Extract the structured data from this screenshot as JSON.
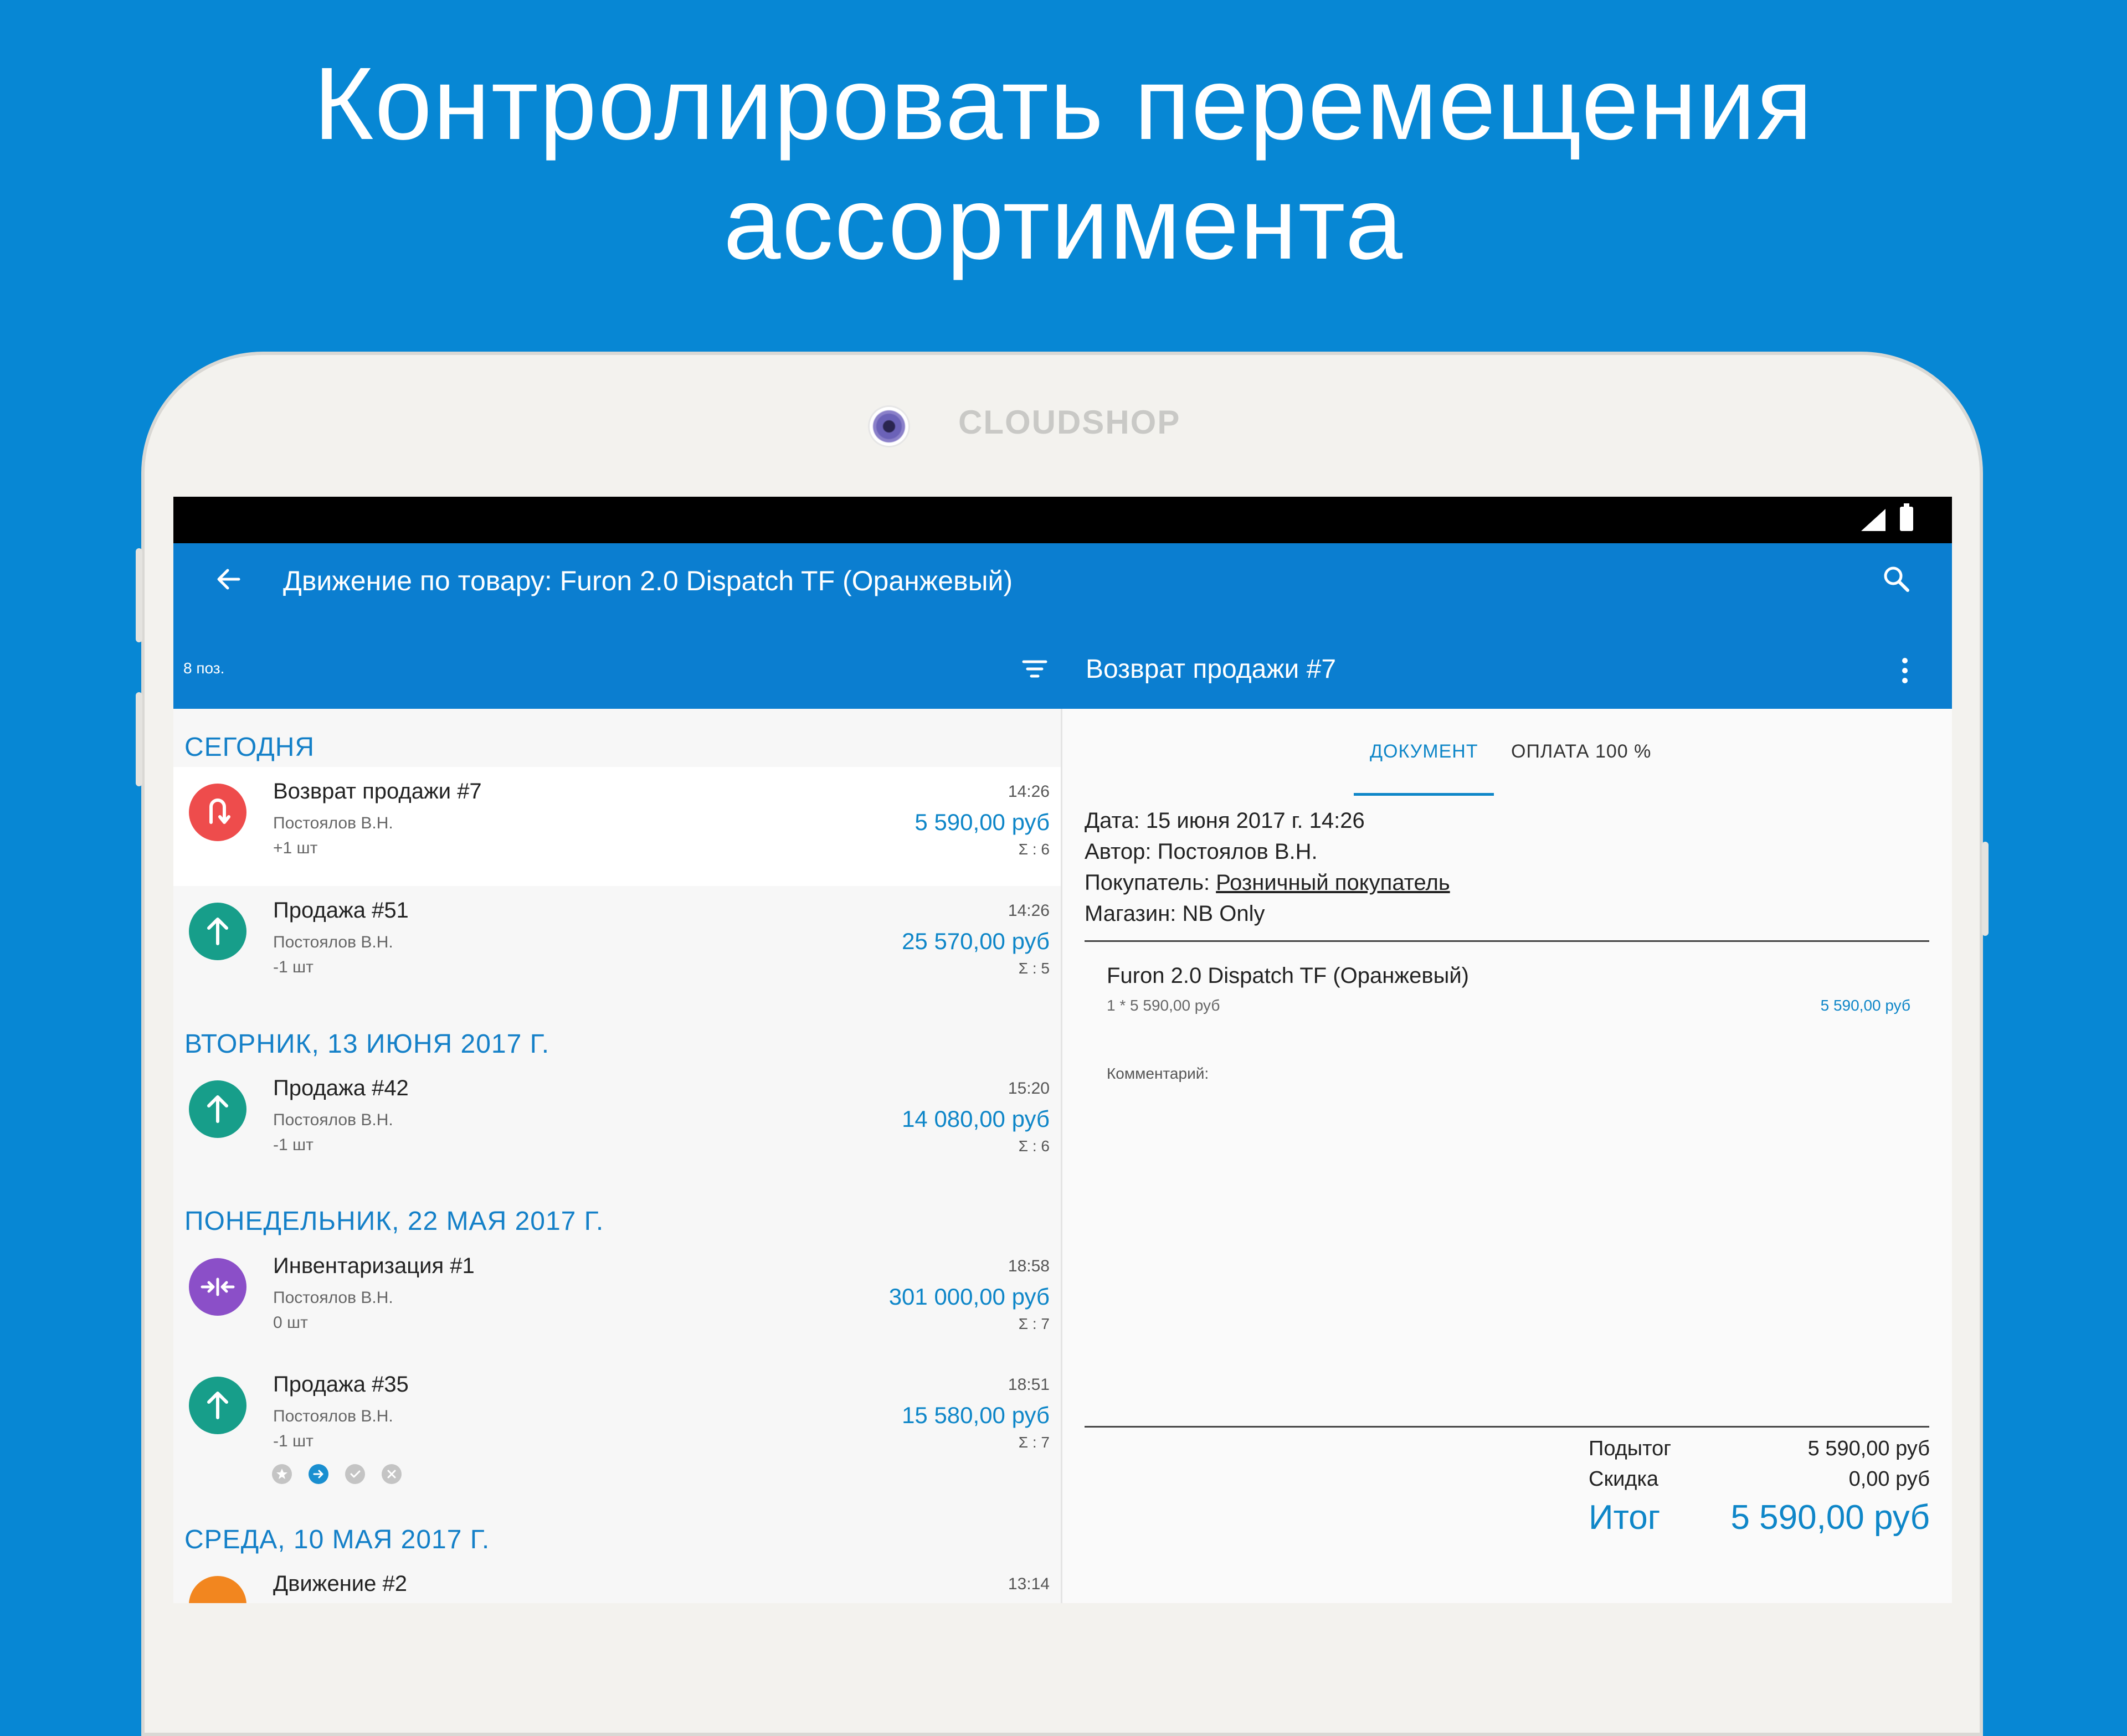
{
  "headline": {
    "line1": "Контролировать перемещения",
    "line2": "ассортимента"
  },
  "device": {
    "brand": "CLOUDSHOP"
  },
  "app": {
    "title": "Движение по товару: Furon 2.0 Dispatch TF (Оранжевый)",
    "count_label": "8 поз.",
    "detail_title": "Возврат продажи #7"
  },
  "list": {
    "sections": [
      "СЕГОДНЯ",
      "ВТОРНИК, 13 ИЮНЯ 2017 Г.",
      "ПОНЕДЕЛЬНИК, 22 МАЯ 2017 Г.",
      "СРЕДА, 10 МАЯ 2017 Г."
    ],
    "items": [
      {
        "title": "Возврат продажи #7",
        "author": "Постоялов В.Н.",
        "qty": "+1 шт",
        "time": "14:26",
        "sum": "5 590,00 руб",
        "count": "Σ : 6",
        "icon": "return-icon",
        "color": "#ee4c4c"
      },
      {
        "title": "Продажа #51",
        "author": "Постоялов В.Н.",
        "qty": "-1 шт",
        "time": "14:26",
        "sum": "25 570,00 руб",
        "count": "Σ : 5",
        "icon": "arrow-up-icon",
        "color": "#179e8a"
      },
      {
        "title": "Продажа #42",
        "author": "Постоялов В.Н.",
        "qty": "-1 шт",
        "time": "15:20",
        "sum": "14 080,00 руб",
        "count": "Σ : 6",
        "icon": "arrow-up-icon",
        "color": "#179e8a"
      },
      {
        "title": "Инвентаризация #1",
        "author": "Постоялов В.Н.",
        "qty": "0 шт",
        "time": "18:58",
        "sum": "301 000,00 руб",
        "count": "Σ : 7",
        "icon": "inventory-icon",
        "color": "#8b4fc8"
      },
      {
        "title": "Продажа #35",
        "author": "Постоялов В.Н.",
        "qty": "-1 шт",
        "time": "18:51",
        "sum": "15 580,00 руб",
        "count": "Σ : 7",
        "icon": "arrow-up-icon",
        "color": "#179e8a"
      },
      {
        "title": "Движение #2",
        "time": "13:14",
        "icon": "transfer-icon",
        "color": "#f2861f"
      }
    ]
  },
  "detail": {
    "tabs": [
      "ДОКУМЕНТ",
      "ОПЛАТА 100 %"
    ],
    "date_label": "Дата: 15 июня 2017 г. 14:26",
    "author_label": "Автор: Постоялов В.Н.",
    "buyer_prefix": "Покупатель: ",
    "buyer_link": "Розничный покупатель",
    "store_label": "Магазин: NB Only",
    "item_name": "Furon 2.0 Dispatch TF (Оранжевый)",
    "item_calc": "1 * 5 590,00 руб",
    "item_sum": "5 590,00 руб",
    "comment_label": "Комментарий:",
    "subtotal_label": "Подытог",
    "subtotal_value": "5 590,00 руб",
    "discount_label": "Скидка",
    "discount_value": "0,00 руб",
    "total_label": "Итог",
    "total_value": "5 590,00 руб"
  }
}
